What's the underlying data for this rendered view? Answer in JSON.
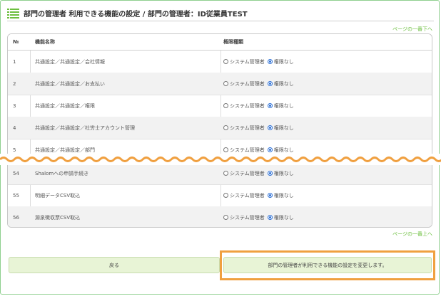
{
  "page": {
    "title": "部門の管理者 利用できる機能の設定 / 部門の管理者：ID従業員TEST",
    "link_to_bottom": "ページの一番下へ",
    "link_to_top": "ページの一番上へ"
  },
  "table": {
    "headers": {
      "no": "№",
      "name": "機能名称",
      "role": "権限種類"
    },
    "radio_labels": {
      "admin": "システム管理者",
      "none": "権限なし"
    },
    "rows": [
      {
        "no": "1",
        "name": "共通設定／共通設定／会社情報",
        "selected": "none"
      },
      {
        "no": "2",
        "name": "共通設定／共通設定／お支払い",
        "selected": "none"
      },
      {
        "no": "3",
        "name": "共通設定／共通設定／権限",
        "selected": "none"
      },
      {
        "no": "4",
        "name": "共通設定／共通設定／社労士アカウント管理",
        "selected": "none"
      },
      {
        "no": "5",
        "name": "共通設定／共通設定／部門",
        "selected": "none"
      },
      {
        "no": "54",
        "name": "Shalomへの申請手続き",
        "selected": "none"
      },
      {
        "no": "55",
        "name": "明細データCSV取込",
        "selected": "none"
      },
      {
        "no": "56",
        "name": "源泉徴収票CSV取込",
        "selected": "none"
      }
    ]
  },
  "buttons": {
    "back": "戻る",
    "save": "部門の管理者が利用できる機能の設定を変更します。"
  },
  "colors": {
    "accent_green": "#6cbf3e",
    "button_bg": "#e8f4d6",
    "highlight_orange": "#f0a040",
    "radio_checked": "#2b6fd6"
  }
}
